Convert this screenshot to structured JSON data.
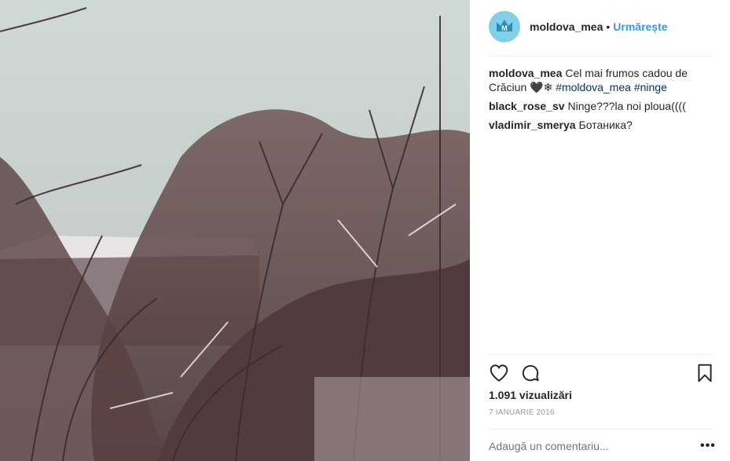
{
  "post": {
    "username": "moldova_mea",
    "separator": "•",
    "follow_label": "Urmărește",
    "caption": {
      "username": "moldova_mea",
      "text": "Cel mai frumos cadou de Crăciun 🖤❄",
      "tags": [
        "#moldova_mea",
        "#ninge"
      ]
    },
    "comments": [
      {
        "username": "black_rose_sv",
        "text": "Ninge???la noi ploua(((("
      },
      {
        "username": "vladimir_smerya",
        "text": "Ботаника?"
      }
    ],
    "views": "1.091 vizualizări",
    "date": "7 IANUARIE 2016",
    "add_comment_placeholder": "Adaugă un comentariu...",
    "more_label": "•••"
  },
  "icons": [
    "avatar-crown-icon",
    "heart-icon",
    "comment-icon",
    "bookmark-icon"
  ],
  "colors": {
    "accent": "#3897f0",
    "hashtag": "#003569",
    "avatar": "#7fd0e8"
  }
}
